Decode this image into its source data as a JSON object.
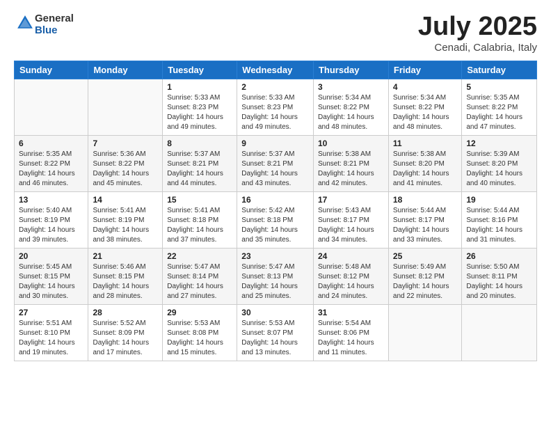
{
  "header": {
    "logo_general": "General",
    "logo_blue": "Blue",
    "month": "July 2025",
    "location": "Cenadi, Calabria, Italy"
  },
  "days_of_week": [
    "Sunday",
    "Monday",
    "Tuesday",
    "Wednesday",
    "Thursday",
    "Friday",
    "Saturday"
  ],
  "weeks": [
    [
      {
        "day": "",
        "content": ""
      },
      {
        "day": "",
        "content": ""
      },
      {
        "day": "1",
        "content": "Sunrise: 5:33 AM\nSunset: 8:23 PM\nDaylight: 14 hours and 49 minutes."
      },
      {
        "day": "2",
        "content": "Sunrise: 5:33 AM\nSunset: 8:23 PM\nDaylight: 14 hours and 49 minutes."
      },
      {
        "day": "3",
        "content": "Sunrise: 5:34 AM\nSunset: 8:22 PM\nDaylight: 14 hours and 48 minutes."
      },
      {
        "day": "4",
        "content": "Sunrise: 5:34 AM\nSunset: 8:22 PM\nDaylight: 14 hours and 48 minutes."
      },
      {
        "day": "5",
        "content": "Sunrise: 5:35 AM\nSunset: 8:22 PM\nDaylight: 14 hours and 47 minutes."
      }
    ],
    [
      {
        "day": "6",
        "content": "Sunrise: 5:35 AM\nSunset: 8:22 PM\nDaylight: 14 hours and 46 minutes."
      },
      {
        "day": "7",
        "content": "Sunrise: 5:36 AM\nSunset: 8:22 PM\nDaylight: 14 hours and 45 minutes."
      },
      {
        "day": "8",
        "content": "Sunrise: 5:37 AM\nSunset: 8:21 PM\nDaylight: 14 hours and 44 minutes."
      },
      {
        "day": "9",
        "content": "Sunrise: 5:37 AM\nSunset: 8:21 PM\nDaylight: 14 hours and 43 minutes."
      },
      {
        "day": "10",
        "content": "Sunrise: 5:38 AM\nSunset: 8:21 PM\nDaylight: 14 hours and 42 minutes."
      },
      {
        "day": "11",
        "content": "Sunrise: 5:38 AM\nSunset: 8:20 PM\nDaylight: 14 hours and 41 minutes."
      },
      {
        "day": "12",
        "content": "Sunrise: 5:39 AM\nSunset: 8:20 PM\nDaylight: 14 hours and 40 minutes."
      }
    ],
    [
      {
        "day": "13",
        "content": "Sunrise: 5:40 AM\nSunset: 8:19 PM\nDaylight: 14 hours and 39 minutes."
      },
      {
        "day": "14",
        "content": "Sunrise: 5:41 AM\nSunset: 8:19 PM\nDaylight: 14 hours and 38 minutes."
      },
      {
        "day": "15",
        "content": "Sunrise: 5:41 AM\nSunset: 8:18 PM\nDaylight: 14 hours and 37 minutes."
      },
      {
        "day": "16",
        "content": "Sunrise: 5:42 AM\nSunset: 8:18 PM\nDaylight: 14 hours and 35 minutes."
      },
      {
        "day": "17",
        "content": "Sunrise: 5:43 AM\nSunset: 8:17 PM\nDaylight: 14 hours and 34 minutes."
      },
      {
        "day": "18",
        "content": "Sunrise: 5:44 AM\nSunset: 8:17 PM\nDaylight: 14 hours and 33 minutes."
      },
      {
        "day": "19",
        "content": "Sunrise: 5:44 AM\nSunset: 8:16 PM\nDaylight: 14 hours and 31 minutes."
      }
    ],
    [
      {
        "day": "20",
        "content": "Sunrise: 5:45 AM\nSunset: 8:15 PM\nDaylight: 14 hours and 30 minutes."
      },
      {
        "day": "21",
        "content": "Sunrise: 5:46 AM\nSunset: 8:15 PM\nDaylight: 14 hours and 28 minutes."
      },
      {
        "day": "22",
        "content": "Sunrise: 5:47 AM\nSunset: 8:14 PM\nDaylight: 14 hours and 27 minutes."
      },
      {
        "day": "23",
        "content": "Sunrise: 5:47 AM\nSunset: 8:13 PM\nDaylight: 14 hours and 25 minutes."
      },
      {
        "day": "24",
        "content": "Sunrise: 5:48 AM\nSunset: 8:12 PM\nDaylight: 14 hours and 24 minutes."
      },
      {
        "day": "25",
        "content": "Sunrise: 5:49 AM\nSunset: 8:12 PM\nDaylight: 14 hours and 22 minutes."
      },
      {
        "day": "26",
        "content": "Sunrise: 5:50 AM\nSunset: 8:11 PM\nDaylight: 14 hours and 20 minutes."
      }
    ],
    [
      {
        "day": "27",
        "content": "Sunrise: 5:51 AM\nSunset: 8:10 PM\nDaylight: 14 hours and 19 minutes."
      },
      {
        "day": "28",
        "content": "Sunrise: 5:52 AM\nSunset: 8:09 PM\nDaylight: 14 hours and 17 minutes."
      },
      {
        "day": "29",
        "content": "Sunrise: 5:53 AM\nSunset: 8:08 PM\nDaylight: 14 hours and 15 minutes."
      },
      {
        "day": "30",
        "content": "Sunrise: 5:53 AM\nSunset: 8:07 PM\nDaylight: 14 hours and 13 minutes."
      },
      {
        "day": "31",
        "content": "Sunrise: 5:54 AM\nSunset: 8:06 PM\nDaylight: 14 hours and 11 minutes."
      },
      {
        "day": "",
        "content": ""
      },
      {
        "day": "",
        "content": ""
      }
    ]
  ]
}
